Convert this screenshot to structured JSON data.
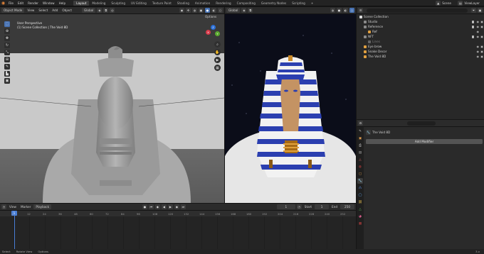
{
  "topbar": {
    "menus": [
      "File",
      "Edit",
      "Render",
      "Window",
      "Help"
    ],
    "workspaces": [
      "Layout",
      "Modeling",
      "Sculpting",
      "UV Editing",
      "Texture Paint",
      "Shading",
      "Animation",
      "Rendering",
      "Compositing",
      "Geometry Nodes",
      "Scripting"
    ],
    "active_workspace": "Layout",
    "add_tab": "+",
    "scene_label": "Scene",
    "viewlayer_label": "ViewLayer"
  },
  "viewport_left": {
    "mode": "Object Mode",
    "menus": [
      "View",
      "Select",
      "Add",
      "Object"
    ],
    "orientation": "Global",
    "options_label": "Options",
    "title": "User Perspective",
    "subtitle": "(1) Scene Collection | The Void 8D"
  },
  "viewport_right": {
    "orientation": "Global",
    "options_label": "Options"
  },
  "gizmo": {
    "x": "X",
    "y": "Y",
    "z": "Z"
  },
  "outliner": {
    "search_placeholder": "",
    "root": "Scene Collection",
    "items": [
      {
        "label": "Studio",
        "level": 1,
        "color": "#8a8a8a"
      },
      {
        "label": "Reference",
        "level": 1,
        "color": "#8a8a8a"
      },
      {
        "label": "Ref",
        "level": 2,
        "color": "#e0a040"
      },
      {
        "label": "NFT",
        "level": 1,
        "color": "#8a8a8a"
      },
      {
        "label": "Lines",
        "level": 2,
        "color": "#666666"
      },
      {
        "label": "Eye brow",
        "level": 1,
        "color": "#e0a040"
      },
      {
        "label": "Snake Decor",
        "level": 1,
        "color": "#e0a040"
      },
      {
        "label": "The Void 8D",
        "level": 1,
        "color": "#e0a040"
      }
    ]
  },
  "properties": {
    "object_name": "The Void 8D",
    "add_modifier_label": "Add Modifier"
  },
  "timeline": {
    "menus": [
      "View",
      "Marker",
      "Playback"
    ],
    "current_frame": "1",
    "start_label": "Start",
    "start_value": "1",
    "end_label": "End",
    "end_value": "250",
    "ticks": [
      "1",
      "12",
      "24",
      "36",
      "48",
      "60",
      "72",
      "84",
      "96",
      "108",
      "120",
      "132",
      "144",
      "156",
      "168",
      "180",
      "192",
      "204",
      "216",
      "228",
      "240",
      "252"
    ]
  },
  "statusbar": {
    "items": [
      "Select",
      "Rotate View",
      "Options"
    ],
    "version": "3.x"
  },
  "colors": {
    "accent": "#4772b3",
    "playhead": "#4a7fd6",
    "object_orange": "#e0a040"
  }
}
